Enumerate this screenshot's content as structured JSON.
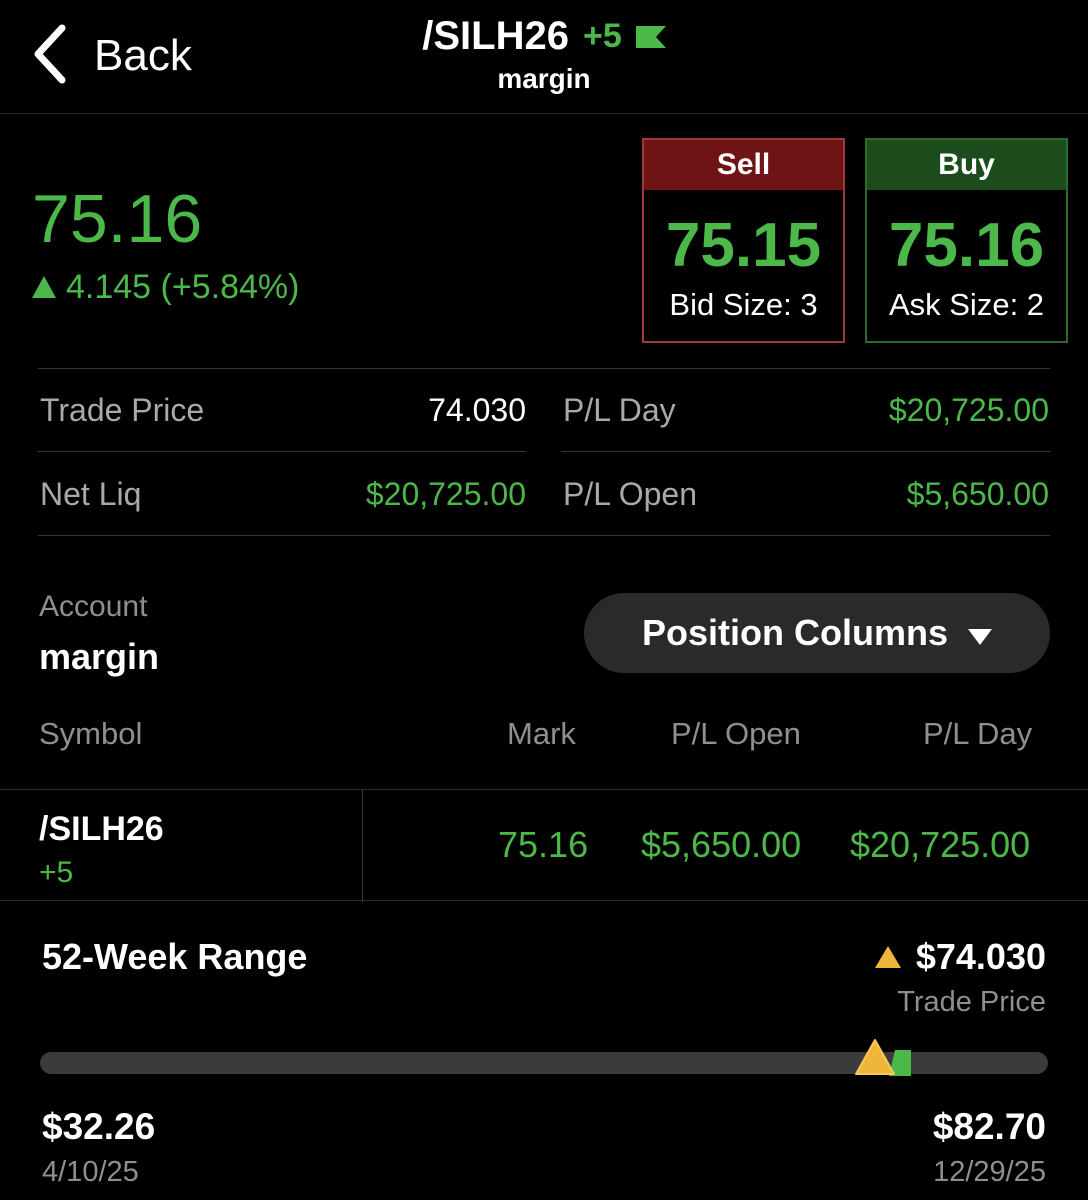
{
  "header": {
    "back_label": "Back",
    "symbol": "/SILH26",
    "position_qty": "+5",
    "account": "margin"
  },
  "quote": {
    "last": "75.16",
    "change": "4.145 (+5.84%)",
    "sell_label": "Sell",
    "bid": "75.15",
    "bid_size": "Bid Size: 3",
    "buy_label": "Buy",
    "ask": "75.16",
    "ask_size": "Ask Size: 2"
  },
  "stats": {
    "trade_price_label": "Trade Price",
    "trade_price": "74.030",
    "pl_day_label": "P/L Day",
    "pl_day": "$20,725.00",
    "net_liq_label": "Net Liq",
    "net_liq": "$20,725.00",
    "pl_open_label": "P/L Open",
    "pl_open": "$5,650.00"
  },
  "account": {
    "label": "Account",
    "value": "margin",
    "columns_button": "Position Columns"
  },
  "columns": {
    "symbol": "Symbol",
    "mark": "Mark",
    "pl_open": "P/L Open",
    "pl_day": "P/L Day"
  },
  "position": {
    "symbol": "/SILH26",
    "qty": "+5",
    "mark": "75.16",
    "pl_open": "$5,650.00",
    "pl_day": "$20,725.00"
  },
  "range": {
    "title": "52-Week Range",
    "trade_price": "$74.030",
    "trade_price_label": "Trade Price",
    "low": "$32.26",
    "low_date": "4/10/25",
    "high": "$82.70",
    "high_date": "12/29/25",
    "low_value": 32.26,
    "high_value": 82.7,
    "trade_value": 74.03,
    "last_value": 75.16
  },
  "colors": {
    "green": "#4cb84a",
    "sell_header": "#6f1414",
    "buy_header": "#1c4b1c",
    "marker": "#f0b63a"
  }
}
